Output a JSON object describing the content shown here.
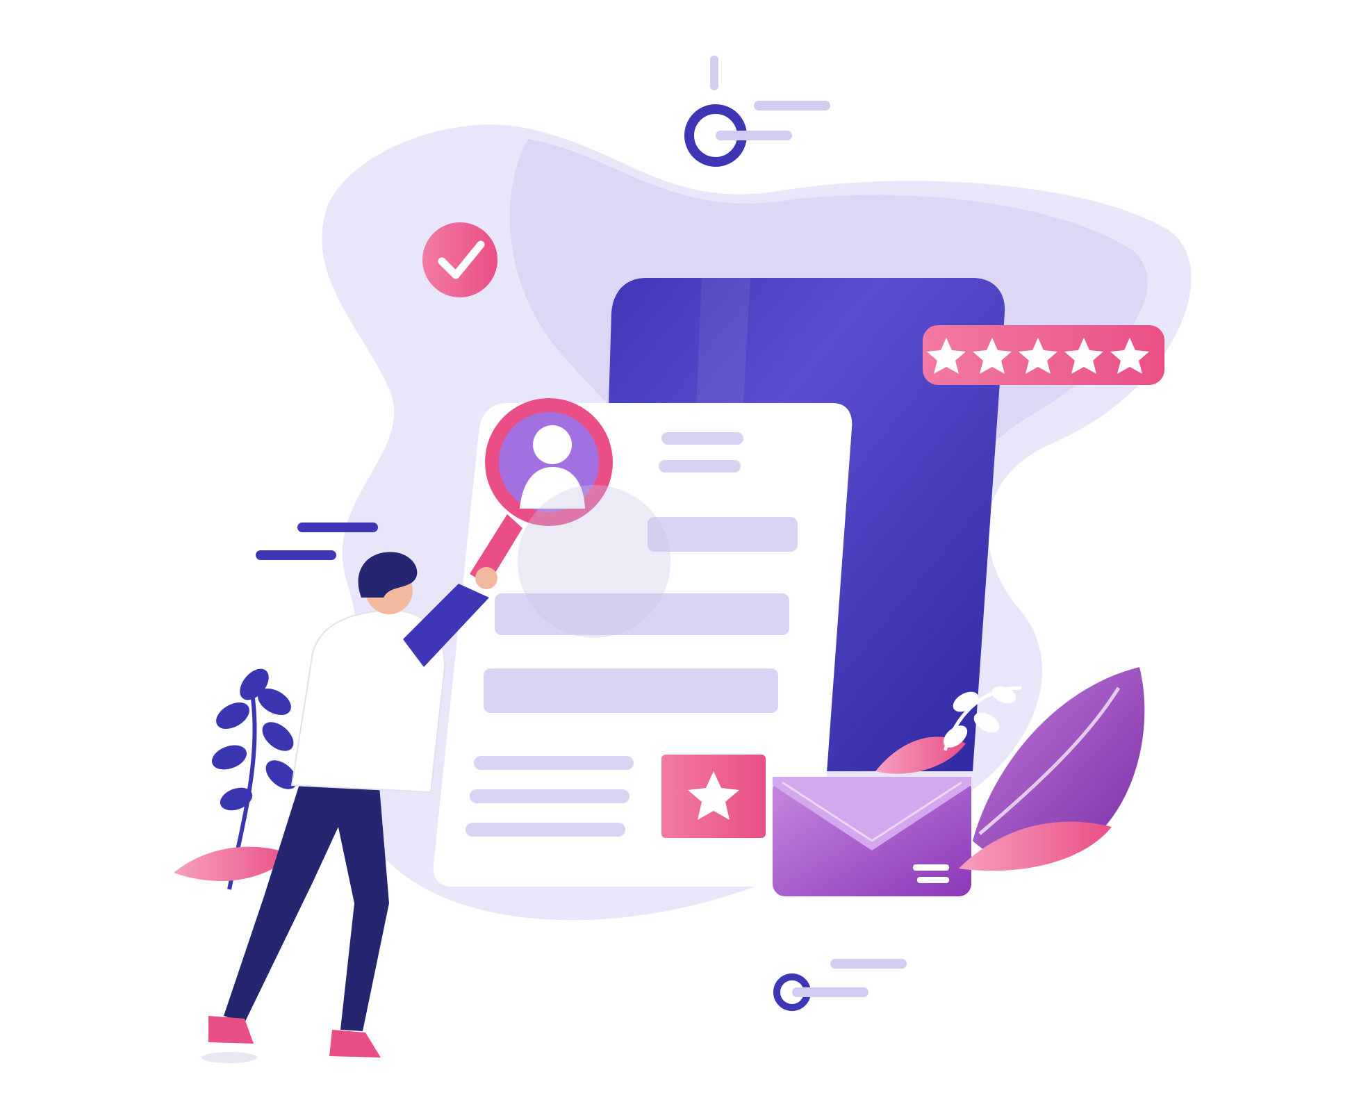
{
  "scene": {
    "kind": "flat-vector-illustration",
    "description_tags": [
      "person",
      "magnifying-glass",
      "profile-document",
      "rating-stars",
      "envelope",
      "plants"
    ]
  },
  "rating": {
    "stars_filled": 5,
    "stars_total": 5
  },
  "colors": {
    "background": "#ffffff",
    "blob_light": "#e9e6f9",
    "blob_mid": "#d9d3f3",
    "phone_indigo": "#3f36b5",
    "phone_indigo_light": "#5b4ed0",
    "accent_pink": "#e94f86",
    "accent_pink_light": "#f27aa4",
    "paper": "#ffffff",
    "paper_line": "#d7d2f2",
    "envelope_purple": "#a24bc6",
    "person_pants": "#252670",
    "person_hair": "#252670",
    "leaf_navy": "#3a35b0",
    "leaf_purple": "#9a4ac2",
    "skin": "#f3b99e"
  },
  "icons": [
    "check-circle-icon",
    "user-profile-icon",
    "star-icon",
    "envelope-icon",
    "magnifying-glass-icon"
  ]
}
